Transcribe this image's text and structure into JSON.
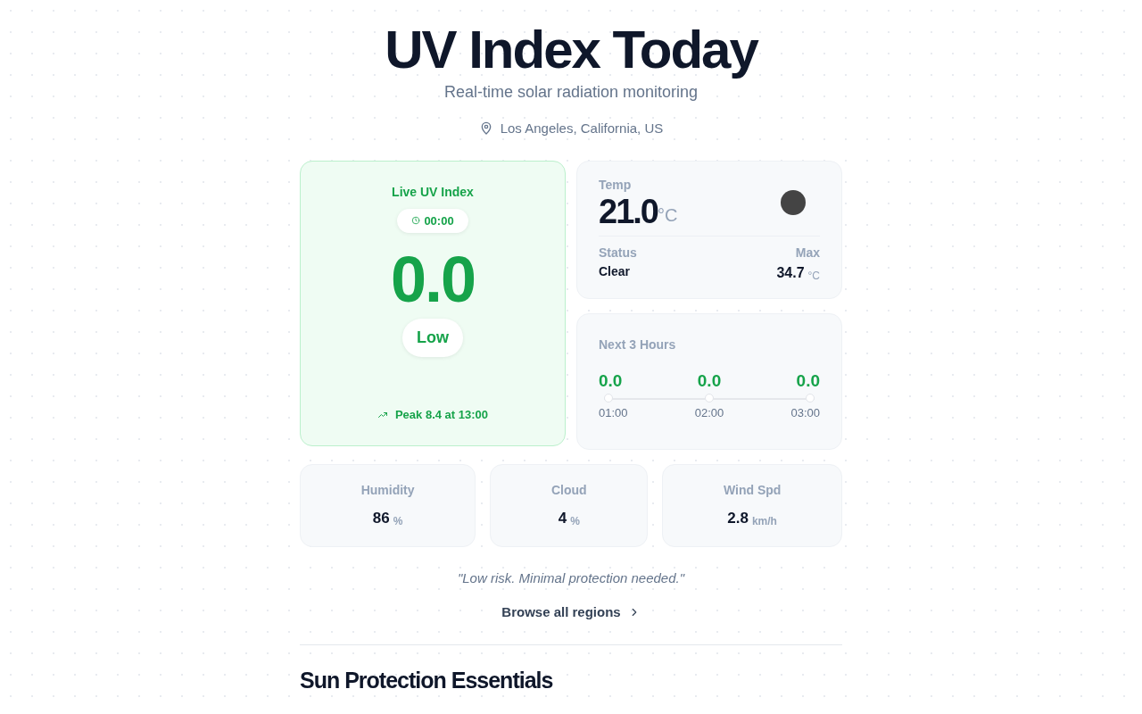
{
  "header": {
    "title": "UV Index Today",
    "subtitle": "Real-time solar radiation monitoring",
    "location": "Los Angeles, California, US"
  },
  "live": {
    "label": "Live UV Index",
    "time": "00:00",
    "value": "0.0",
    "level_label": "Low",
    "peak": "Peak 8.4 at 13:00"
  },
  "weather": {
    "temp_label": "Temp",
    "temp": "21.0",
    "temp_unit": "°C",
    "status_label": "Status",
    "status": "Clear",
    "max_label": "Max",
    "max": "34.7",
    "max_unit": "°C"
  },
  "forecast": {
    "title": "Next 3 Hours",
    "hours": [
      {
        "value": "0.0",
        "time": "01:00"
      },
      {
        "value": "0.0",
        "time": "02:00"
      },
      {
        "value": "0.0",
        "time": "03:00"
      }
    ]
  },
  "stats": [
    {
      "label": "Humidity",
      "value": "86",
      "unit": "%"
    },
    {
      "label": "Cloud",
      "value": "4",
      "unit": "%"
    },
    {
      "label": "Wind Spd",
      "value": "2.8",
      "unit": "km/h"
    }
  ],
  "advice": "\"Low risk. Minimal protection needed.\"",
  "browse_link": "Browse all regions",
  "section_title": "Sun Protection Essentials"
}
